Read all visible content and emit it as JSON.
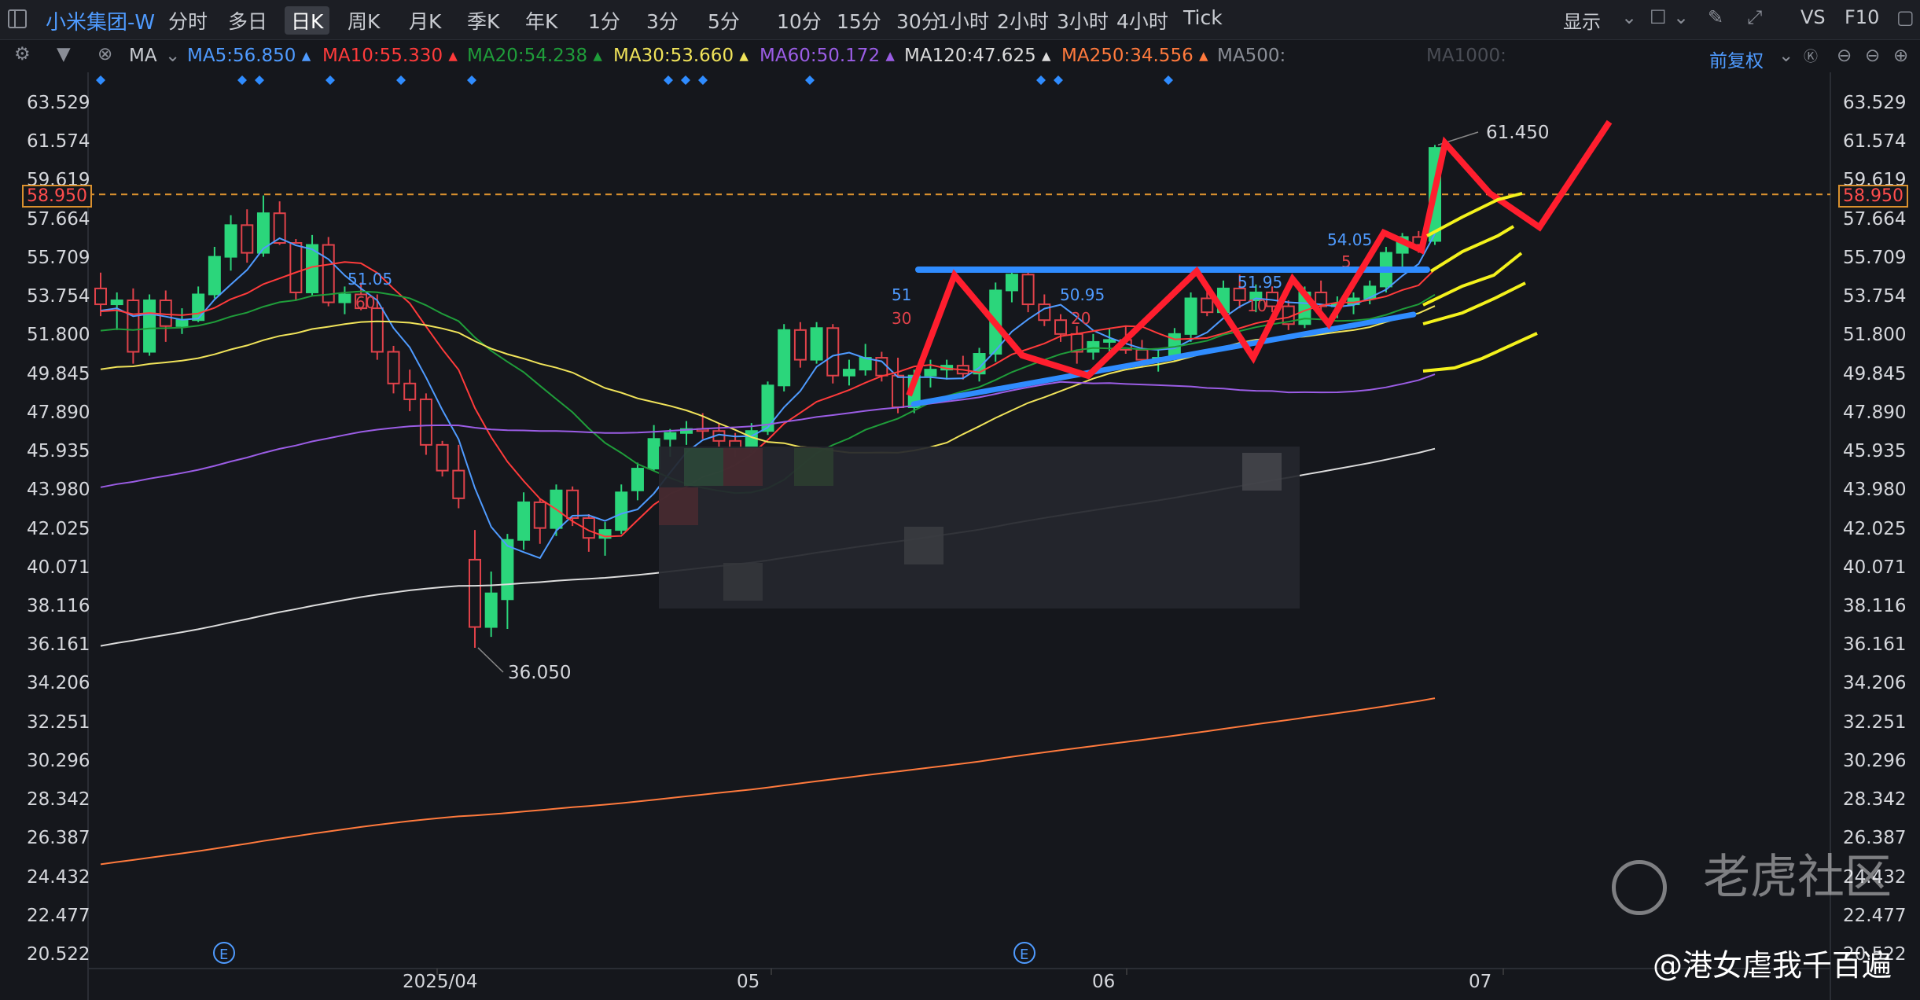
{
  "toolbar": {
    "stock_name": "小米集团-W",
    "timeframes": [
      "分时",
      "多日",
      "日K",
      "周K",
      "月K",
      "季K",
      "年K",
      "1分",
      "3分",
      "5分",
      "10分",
      "15分",
      "30分",
      "1小时",
      "2小时",
      "3小时",
      "4小时",
      "Tick"
    ],
    "active_timeframe": "日K",
    "right_items": [
      "显示",
      "VS",
      "F10"
    ]
  },
  "ma_bar": {
    "label": "MA",
    "items": [
      {
        "text": "MA5:56.850",
        "color": "#4f9bff"
      },
      {
        "text": "MA10:55.330",
        "color": "#ff3b3b"
      },
      {
        "text": "MA20:54.238",
        "color": "#1f9d3a"
      },
      {
        "text": "MA30:53.660",
        "color": "#f0e35a"
      },
      {
        "text": "MA60:50.172",
        "color": "#9b5de5"
      },
      {
        "text": "MA120:47.625",
        "color": "#dcdcdc"
      },
      {
        "text": "MA250:34.556",
        "color": "#ff7a3d"
      },
      {
        "text": "MA500:",
        "color": "#8a8e97"
      },
      {
        "text": "MA1000:",
        "color": "#4a4d55"
      }
    ],
    "adjust_label": "前复权"
  },
  "price_axis": [
    "63.529",
    "61.574",
    "59.619",
    "57.664",
    "55.709",
    "53.754",
    "51.800",
    "49.845",
    "47.890",
    "45.935",
    "43.980",
    "42.025",
    "40.071",
    "38.116",
    "36.161",
    "34.206",
    "32.251",
    "30.296",
    "28.342",
    "26.387",
    "24.432",
    "22.477",
    "20.522"
  ],
  "current_price": "58.950",
  "date_axis": [
    "2025/04",
    "05",
    "06",
    "07"
  ],
  "annotations": {
    "high": "61.450",
    "low": "36.050",
    "ma_marks": [
      "51.05",
      "60",
      "51",
      "30",
      "50.95",
      "20",
      "51.95",
      "10",
      "54.05",
      "5"
    ]
  },
  "chart_data": {
    "type": "candlestick",
    "title": "小米集团-W 日K",
    "ylim": [
      20.522,
      63.529
    ],
    "x_ticks": [
      "2025/04",
      "05",
      "06",
      "07"
    ],
    "candles": [
      [
        54.2,
        55.0,
        52.8,
        53.4
      ],
      [
        53.4,
        54.0,
        52.1,
        53.6
      ],
      [
        53.6,
        54.2,
        50.4,
        51.0
      ],
      [
        51.0,
        53.9,
        50.8,
        53.6
      ],
      [
        53.6,
        54.1,
        51.5,
        52.3
      ],
      [
        52.3,
        53.2,
        51.9,
        52.6
      ],
      [
        52.6,
        54.3,
        52.5,
        53.9
      ],
      [
        53.9,
        56.3,
        53.7,
        55.8
      ],
      [
        55.8,
        57.9,
        55.1,
        57.4
      ],
      [
        57.4,
        58.2,
        55.5,
        56.0
      ],
      [
        56.0,
        58.9,
        55.8,
        58.0
      ],
      [
        58.0,
        58.6,
        56.4,
        56.5
      ],
      [
        56.5,
        56.7,
        53.6,
        54.0
      ],
      [
        54.0,
        56.9,
        53.8,
        56.4
      ],
      [
        56.4,
        56.8,
        53.3,
        53.5
      ],
      [
        53.5,
        54.3,
        52.9,
        53.9
      ],
      [
        53.9,
        54.5,
        53.1,
        53.2
      ],
      [
        53.2,
        53.9,
        50.6,
        51.0
      ],
      [
        51.0,
        51.3,
        48.9,
        49.4
      ],
      [
        49.4,
        50.1,
        48.0,
        48.6
      ],
      [
        48.6,
        48.9,
        45.8,
        46.3
      ],
      [
        46.3,
        46.5,
        44.7,
        45.0
      ],
      [
        45.0,
        46.3,
        43.1,
        43.6
      ],
      [
        40.5,
        42.0,
        36.05,
        37.1
      ],
      [
        37.1,
        39.9,
        36.6,
        38.8
      ],
      [
        38.5,
        41.8,
        37.0,
        41.5
      ],
      [
        41.5,
        43.9,
        41.0,
        43.4
      ],
      [
        43.4,
        43.6,
        41.3,
        42.1
      ],
      [
        42.1,
        44.3,
        41.7,
        44.0
      ],
      [
        44.0,
        44.2,
        42.2,
        42.6
      ],
      [
        42.6,
        42.8,
        40.9,
        41.6
      ],
      [
        41.6,
        42.4,
        40.7,
        42.0
      ],
      [
        42.0,
        44.3,
        41.8,
        43.9
      ],
      [
        44.0,
        45.4,
        43.5,
        45.1
      ],
      [
        45.1,
        47.3,
        45.0,
        46.6
      ],
      [
        46.6,
        47.1,
        45.7,
        46.9
      ],
      [
        46.9,
        47.5,
        46.3,
        47.1
      ],
      [
        47.1,
        47.9,
        46.6,
        47.0
      ],
      [
        47.0,
        47.4,
        46.2,
        46.5
      ],
      [
        46.5,
        46.9,
        45.7,
        46.1
      ],
      [
        46.1,
        47.4,
        45.9,
        47.0
      ],
      [
        47.0,
        49.5,
        46.8,
        49.3
      ],
      [
        49.3,
        52.4,
        49.0,
        52.1
      ],
      [
        52.1,
        52.5,
        50.2,
        50.6
      ],
      [
        50.6,
        52.5,
        50.4,
        52.2
      ],
      [
        52.2,
        52.4,
        49.4,
        49.8
      ],
      [
        49.8,
        50.6,
        49.3,
        50.1
      ],
      [
        50.1,
        51.4,
        49.8,
        50.7
      ],
      [
        50.7,
        51.0,
        49.5,
        49.8
      ],
      [
        49.8,
        50.7,
        47.9,
        48.2
      ],
      [
        48.2,
        50.1,
        47.9,
        49.8
      ],
      [
        49.8,
        50.6,
        49.2,
        50.1
      ],
      [
        50.1,
        50.6,
        49.6,
        50.3
      ],
      [
        50.3,
        50.8,
        49.6,
        49.9
      ],
      [
        49.9,
        51.2,
        49.5,
        50.9
      ],
      [
        50.9,
        54.5,
        50.5,
        54.1
      ],
      [
        54.1,
        55.2,
        53.5,
        54.9
      ],
      [
        54.9,
        55.3,
        53.0,
        53.4
      ],
      [
        53.4,
        53.9,
        52.3,
        52.6
      ],
      [
        52.6,
        52.9,
        51.5,
        51.9
      ],
      [
        51.9,
        52.3,
        50.4,
        51.0
      ],
      [
        51.0,
        51.9,
        50.6,
        51.5
      ],
      [
        51.5,
        52.2,
        50.8,
        51.6
      ],
      [
        51.6,
        52.3,
        50.9,
        51.1
      ],
      [
        51.1,
        51.6,
        50.2,
        50.6
      ],
      [
        50.6,
        51.1,
        50.0,
        50.7
      ],
      [
        50.7,
        52.2,
        50.5,
        51.9
      ],
      [
        51.9,
        54.0,
        51.5,
        53.7
      ],
      [
        53.7,
        54.3,
        52.8,
        53.0
      ],
      [
        53.0,
        54.6,
        52.8,
        54.2
      ],
      [
        54.2,
        54.9,
        53.2,
        53.6
      ],
      [
        53.6,
        54.4,
        53.0,
        54.0
      ],
      [
        54.0,
        54.3,
        53.0,
        53.3
      ],
      [
        53.3,
        53.6,
        52.1,
        52.4
      ],
      [
        52.4,
        54.3,
        52.2,
        54.0
      ],
      [
        54.0,
        54.6,
        52.9,
        53.3
      ],
      [
        53.3,
        53.8,
        52.7,
        53.4
      ],
      [
        53.4,
        54.0,
        52.9,
        53.7
      ],
      [
        53.7,
        54.6,
        53.4,
        54.3
      ],
      [
        54.3,
        56.3,
        54.0,
        56.0
      ],
      [
        56.0,
        57.0,
        55.2,
        56.8
      ],
      [
        56.8,
        57.1,
        56.0,
        56.4
      ],
      [
        56.6,
        61.45,
        56.4,
        61.3
      ]
    ],
    "ma_lines": [
      {
        "name": "MA5",
        "color": "#4f9bff"
      },
      {
        "name": "MA10",
        "color": "#ff3b3b"
      },
      {
        "name": "MA20",
        "color": "#1f9d3a"
      },
      {
        "name": "MA30",
        "color": "#f0e35a"
      },
      {
        "name": "MA60",
        "color": "#9b5de5"
      },
      {
        "name": "MA120",
        "color": "#dcdcdc"
      },
      {
        "name": "MA250",
        "color": "#ff7a3d"
      }
    ]
  },
  "watermark": {
    "brand": "老虎社区",
    "user": "@港女虐我千百遍"
  }
}
